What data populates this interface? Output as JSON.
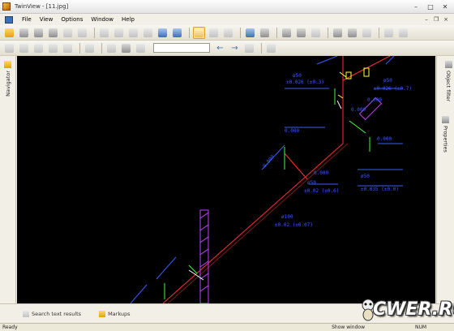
{
  "window": {
    "title": "TwinView - [11.jpg]"
  },
  "menu": {
    "items": [
      "File",
      "View",
      "Options",
      "Window",
      "Help"
    ]
  },
  "left_panel": {
    "tab_label": "Navigator"
  },
  "right_panel": {
    "tabs": [
      "Object filter",
      "Properties"
    ]
  },
  "bottom_tabs": [
    "Search text results",
    "Markups"
  ],
  "status": {
    "ready": "Ready",
    "show_window": "Show window",
    "num": "NUM"
  },
  "drawing": {
    "labels": {
      "d50_top": "ø50",
      "l1": "±0.026 (±0.3)",
      "d50_right": "ø50",
      "l2": "±0.026 (±0.7)",
      "v1": "0.000",
      "v2": "0.000",
      "v3": "0.000",
      "v4": "0.000",
      "v5": "0.000",
      "v6": "0.000",
      "d50_mid": "ø50",
      "l3": "±0.02 (±0.6)",
      "d50_mid2": "ø50",
      "l4": "±0.035 (±0.0)",
      "d100": "ø100",
      "l5": "±0.02 (±0.07)"
    }
  },
  "colors": {
    "pipe": "#ff3030",
    "annot": "#3a5cff",
    "green": "#40ff40",
    "yellow": "#ffff40",
    "hatch": "#c040ff"
  },
  "watermark": {
    "text": "CWER.RU"
  }
}
